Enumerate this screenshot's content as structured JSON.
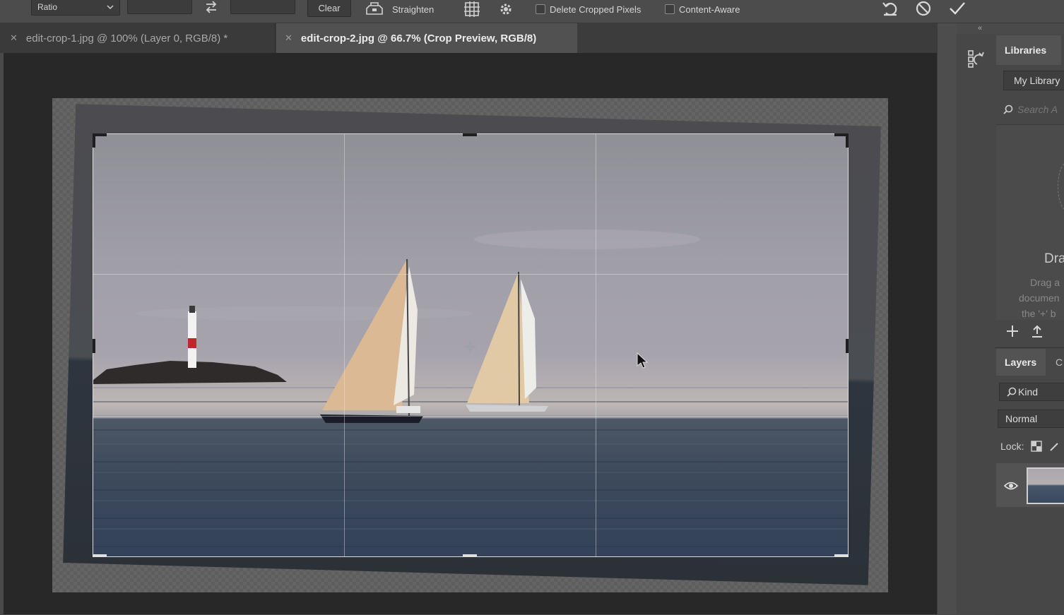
{
  "options_bar": {
    "ratio_label": "Ratio",
    "clear_label": "Clear",
    "straighten_label": "Straighten",
    "delete_cropped_label": "Delete Cropped Pixels",
    "content_aware_label": "Content-Aware"
  },
  "tabs": [
    {
      "label": "edit-crop-1.jpg @ 100% (Layer 0, RGB/8) *",
      "active": false
    },
    {
      "label": "edit-crop-2.jpg @ 66.7% (Crop Preview, RGB/8)",
      "active": true
    }
  ],
  "libraries": {
    "tab_label": "Libraries",
    "library_name": "My Library",
    "search_placeholder": "Search A",
    "drag_title": "Dra",
    "drag_text": [
      "Drag a",
      "documen",
      "the '+' b"
    ]
  },
  "layers": {
    "tab_label": "Layers",
    "channels_tab_label": "C",
    "kind_label": "Kind",
    "blend_mode": "Normal",
    "lock_label": "Lock:"
  },
  "colors": {
    "panel_bg": "#474747",
    "canvas_bg": "#282828",
    "options_bg": "#4c4c4c",
    "active_tab": "#515151"
  }
}
